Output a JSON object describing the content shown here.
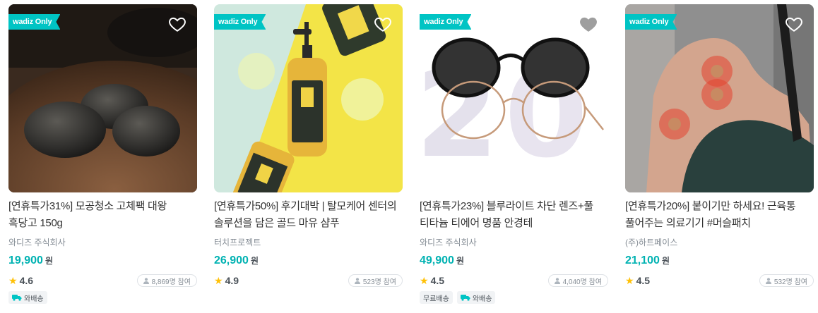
{
  "products": [
    {
      "badge": "wadiz Only",
      "title": "[연휴특가31%] 모공청소 고체팩 대왕 흑당고 150g",
      "maker": "와디즈 주식회사",
      "price": "19,900",
      "price_unit": "원",
      "rating": "4.6",
      "participants": "8,869명 참여",
      "tags": [
        "와배송"
      ],
      "heart_color": "#ffffff"
    },
    {
      "badge": "wadiz Only",
      "title": "[연휴특가50%] 후기대박 | 탈모케어 센터의 솔루션을 담은 골드 마유 샴푸",
      "maker": "터치프로젝트",
      "price": "26,900",
      "price_unit": "원",
      "rating": "4.9",
      "participants": "523명 참여",
      "tags": [],
      "heart_color": "#ffffff"
    },
    {
      "badge": "wadiz Only",
      "title": "[연휴특가23%] 블루라이트 차단 렌즈+풀 티타늄 티에어 명품 안경테",
      "maker": "와디즈 주식회사",
      "price": "49,900",
      "price_unit": "원",
      "rating": "4.5",
      "participants": "4,040명 참여",
      "tags": [
        "무료배송",
        "와배송"
      ],
      "heart_color": "#9e9e9e"
    },
    {
      "badge": "wadiz Only",
      "title": "[연휴특가20%] 붙이기만 하세요! 근육통 풀어주는 의료기기 #머슬패치",
      "maker": "(주)하트페이스",
      "price": "21,100",
      "price_unit": "원",
      "rating": "4.5",
      "participants": "532명 참여",
      "tags": [],
      "heart_color": "#ffffff"
    }
  ],
  "colors": {
    "accent": "#00c4c4",
    "price": "#00b2b2",
    "star": "#ffc107"
  }
}
